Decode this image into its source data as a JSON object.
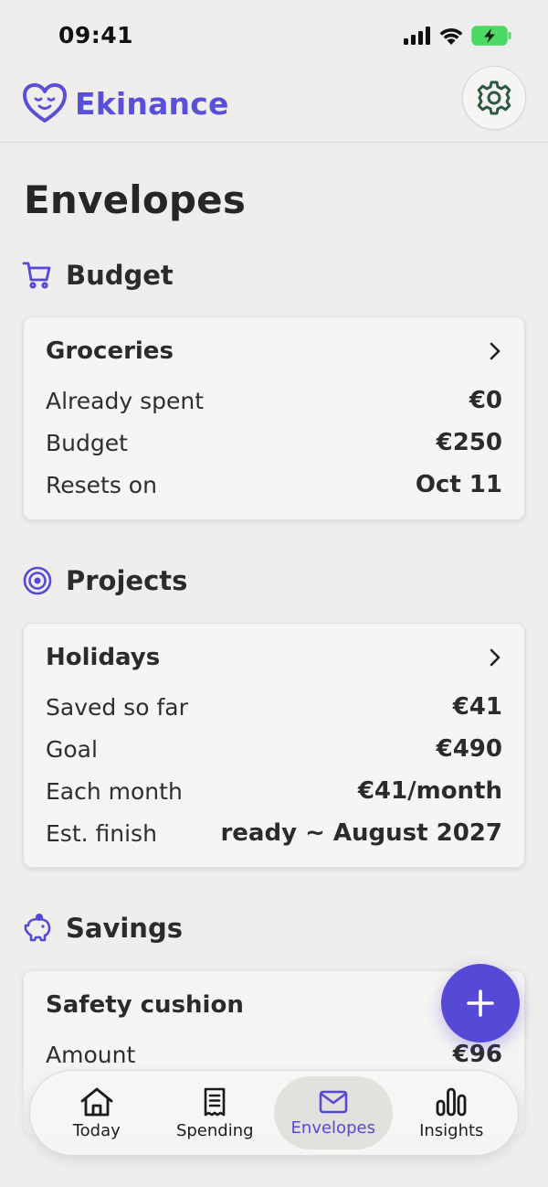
{
  "status": {
    "time": "09:41"
  },
  "app": {
    "name": "Ekinance"
  },
  "page": {
    "title": "Envelopes"
  },
  "colors": {
    "accent": "#5549d6",
    "battery": "#4cd964",
    "background": "#efeeec"
  },
  "sections": {
    "budget": {
      "title": "Budget",
      "icon": "cart-icon",
      "card": {
        "title": "Groceries",
        "rows": [
          {
            "label": "Already spent",
            "value": "€0"
          },
          {
            "label": "Budget",
            "value": "€250"
          },
          {
            "label": "Resets on",
            "value": "Oct 11"
          }
        ]
      }
    },
    "projects": {
      "title": "Projects",
      "icon": "target-icon",
      "card": {
        "title": "Holidays",
        "rows": [
          {
            "label": "Saved so far",
            "value": "€41"
          },
          {
            "label": "Goal",
            "value": "€490"
          },
          {
            "label": "Each month",
            "value": "€41/month"
          },
          {
            "label": "Est. finish",
            "value": "ready ~ August 2027"
          }
        ]
      }
    },
    "savings": {
      "title": "Savings",
      "icon": "piggy-bank-icon",
      "card": {
        "title": "Safety cushion",
        "rows": [
          {
            "label": "Amount",
            "value": "€96"
          }
        ]
      }
    }
  },
  "tabs": [
    {
      "label": "Today",
      "icon": "home-icon",
      "active": false
    },
    {
      "label": "Spending",
      "icon": "receipt-icon",
      "active": false
    },
    {
      "label": "Envelopes",
      "icon": "envelope-icon",
      "active": true
    },
    {
      "label": "Insights",
      "icon": "bar-chart-icon",
      "active": false
    }
  ]
}
